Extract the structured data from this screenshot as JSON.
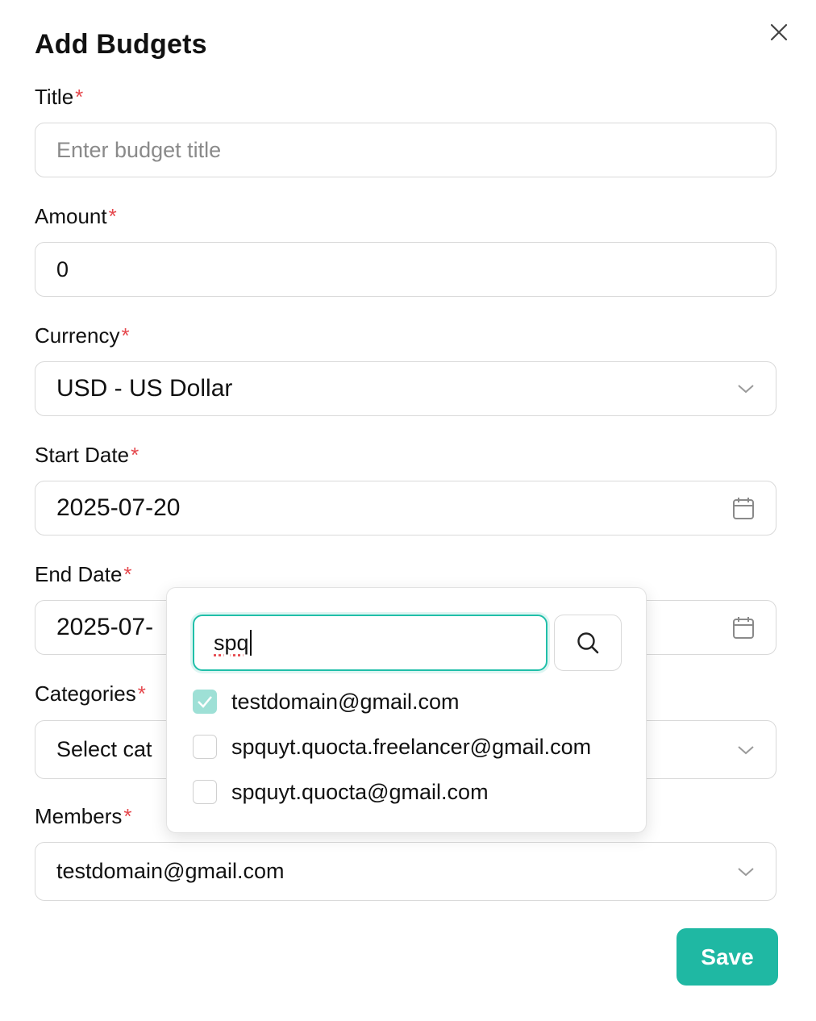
{
  "modal": {
    "title": "Add Budgets",
    "close_icon": "close-icon"
  },
  "fields": {
    "title": {
      "label": "Title",
      "required": "*",
      "placeholder": "Enter budget title"
    },
    "amount": {
      "label": "Amount",
      "required": "*",
      "value": "0"
    },
    "currency": {
      "label": "Currency",
      "required": "*",
      "value": "USD - US Dollar",
      "icon": "chevron-down-icon"
    },
    "start_date": {
      "label": "Start Date",
      "required": "*",
      "value": "2025-07-20",
      "icon": "calendar-icon"
    },
    "end_date": {
      "label": "End Date",
      "required": "*",
      "value": "2025-07-",
      "icon": "calendar-icon"
    },
    "categories": {
      "label": "Categories",
      "required": "*",
      "value": "Select cat",
      "icon": "chevron-down-icon"
    },
    "members": {
      "label": "Members",
      "required": "*",
      "value": "testdomain@gmail.com",
      "icon": "chevron-down-icon"
    }
  },
  "members_dropdown": {
    "search_value": "spq",
    "search_icon": "search-icon",
    "options": [
      {
        "label": "testdomain@gmail.com",
        "checked": true
      },
      {
        "label": "spquyt.quocta.freelancer@gmail.com",
        "checked": false
      },
      {
        "label": "spquyt.quocta@gmail.com",
        "checked": false
      }
    ]
  },
  "actions": {
    "save_label": "Save"
  },
  "colors": {
    "accent": "#1fb8a3",
    "required": "#e5484d",
    "checked_box": "#9ee0d6"
  }
}
